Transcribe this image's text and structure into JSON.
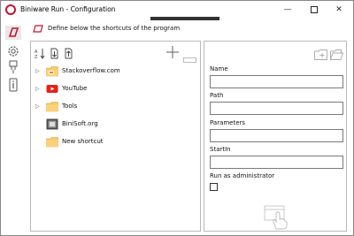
{
  "window": {
    "title": "Biniware Run - Configuration",
    "accent_color": "#c8102e",
    "controls": {
      "minimize": "—",
      "close": "✕"
    }
  },
  "rail": [
    {
      "icon": "run-icon"
    },
    {
      "icon": "gear-icon"
    },
    {
      "icon": "plug-icon"
    },
    {
      "icon": "info-icon"
    }
  ],
  "header": {
    "text": "Define below the shortcuts of the program"
  },
  "tree": {
    "items": [
      {
        "label": "Stackoverflow.com",
        "icon": "folder-icon",
        "expandable": true
      },
      {
        "label": "YouTube",
        "icon": "youtube-icon",
        "expandable": true
      },
      {
        "label": "Tools",
        "icon": "folder-icon",
        "expandable": true
      },
      {
        "label": "BiniSoft.org",
        "icon": "website-icon",
        "expandable": false
      },
      {
        "label": "New shortcut",
        "icon": "folder-icon",
        "expandable": false
      }
    ],
    "expander_glyph": "▷"
  },
  "form": {
    "name_label": "Name",
    "name_value": "",
    "path_label": "Path",
    "path_value": "",
    "parameters_label": "Parameters",
    "parameters_value": "",
    "startin_label": "StartIn",
    "startin_value": "",
    "admin_label": "Run as administrator",
    "admin_checked": false
  }
}
